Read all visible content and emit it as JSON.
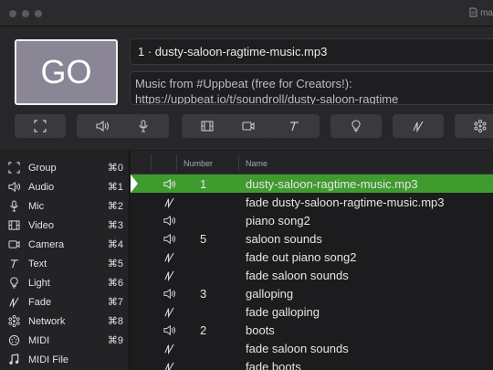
{
  "window": {
    "title_fragment": "ma"
  },
  "go_button": {
    "label": "GO"
  },
  "cue_title": "1 · dusty-saloon-ragtime-music.mp3",
  "cue_notes": {
    "line1": "Music from #Uppbeat (free for Creators!):",
    "line2": "https://uppbeat.io/t/soundroll/dusty-saloon-ragtime"
  },
  "toolbar": [
    {
      "icon": "group-icon"
    },
    {
      "icon": "audio-icon"
    },
    {
      "icon": "mic-icon"
    },
    {
      "icon": "video-icon"
    },
    {
      "icon": "camera-icon"
    },
    {
      "icon": "text-icon"
    },
    {
      "icon": "light-icon"
    },
    {
      "icon": "fade-icon"
    },
    {
      "icon": "network-icon"
    }
  ],
  "sidebar": {
    "items": [
      {
        "label": "Group",
        "shortcut": "⌘0",
        "icon": "group-icon"
      },
      {
        "label": "Audio",
        "shortcut": "⌘1",
        "icon": "audio-icon"
      },
      {
        "label": "Mic",
        "shortcut": "⌘2",
        "icon": "mic-icon"
      },
      {
        "label": "Video",
        "shortcut": "⌘3",
        "icon": "video-icon"
      },
      {
        "label": "Camera",
        "shortcut": "⌘4",
        "icon": "camera-icon"
      },
      {
        "label": "Text",
        "shortcut": "⌘5",
        "icon": "text-icon"
      },
      {
        "label": "Light",
        "shortcut": "⌘6",
        "icon": "light-icon"
      },
      {
        "label": "Fade",
        "shortcut": "⌘7",
        "icon": "fade-icon"
      },
      {
        "label": "Network",
        "shortcut": "⌘8",
        "icon": "network-icon"
      },
      {
        "label": "MIDI",
        "shortcut": "⌘9",
        "icon": "midi-icon"
      },
      {
        "label": "MIDI File",
        "shortcut": "",
        "icon": "midi-file-icon"
      }
    ]
  },
  "cue_list": {
    "headers": {
      "number": "Number",
      "name": "Name"
    },
    "rows": [
      {
        "type": "audio",
        "number": "1",
        "name": "dusty-saloon-ragtime-music.mp3",
        "selected": true
      },
      {
        "type": "fade",
        "number": "",
        "name": "fade dusty-saloon-ragtime-music.mp3"
      },
      {
        "type": "audio",
        "number": "",
        "name": "piano song2"
      },
      {
        "type": "audio",
        "number": "5",
        "name": "saloon sounds"
      },
      {
        "type": "fade",
        "number": "",
        "name": "fade out piano song2"
      },
      {
        "type": "fade",
        "number": "",
        "name": "fade saloon sounds"
      },
      {
        "type": "audio",
        "number": "3",
        "name": "galloping"
      },
      {
        "type": "fade",
        "number": "",
        "name": "fade galloping"
      },
      {
        "type": "audio",
        "number": "2",
        "name": "boots"
      },
      {
        "type": "fade",
        "number": "",
        "name": "fade saloon sounds"
      },
      {
        "type": "fade",
        "number": "",
        "name": "fade boots"
      }
    ]
  },
  "colors": {
    "selection": "#3f9b2e",
    "go_fill": "#8a8696"
  }
}
